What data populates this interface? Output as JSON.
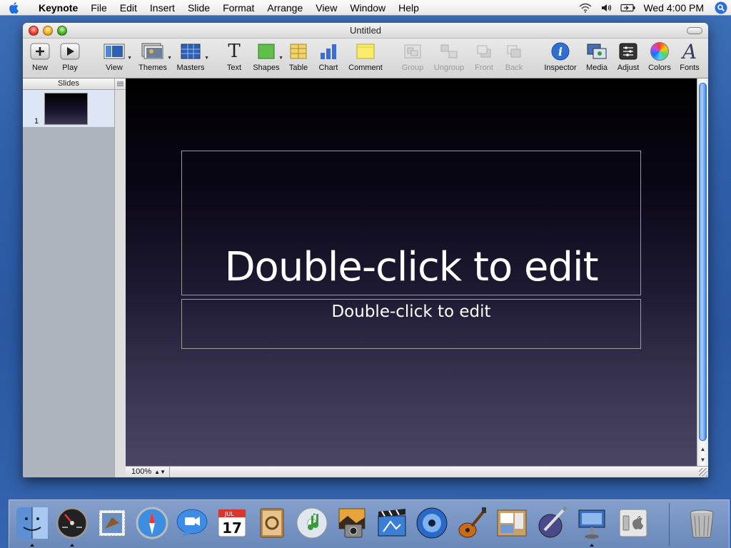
{
  "menubar": {
    "app": "Keynote",
    "items": [
      "File",
      "Edit",
      "Insert",
      "Slide",
      "Format",
      "Arrange",
      "View",
      "Window",
      "Help"
    ],
    "clock": "Wed 4:00 PM",
    "status_icons": [
      "wifi-icon",
      "volume-icon",
      "battery-icon"
    ]
  },
  "window": {
    "title": "Untitled"
  },
  "toolbar": {
    "new": "New",
    "play": "Play",
    "view": "View",
    "themes": "Themes",
    "masters": "Masters",
    "text": "Text",
    "shapes": "Shapes",
    "table": "Table",
    "chart": "Chart",
    "comment": "Comment",
    "group": "Group",
    "ungroup": "Ungroup",
    "front": "Front",
    "back": "Back",
    "inspector": "Inspector",
    "media": "Media",
    "adjust": "Adjust",
    "colors": "Colors",
    "fonts": "Fonts",
    "text_glyph": "T",
    "inspector_glyph": "i",
    "fonts_glyph": "A"
  },
  "navigator": {
    "header": "Slides",
    "slides": [
      {
        "number": "1"
      }
    ]
  },
  "slide": {
    "title_placeholder": "Double-click to edit",
    "body_placeholder": "Double-click to edit"
  },
  "bottombar": {
    "zoom": "100%"
  },
  "dock": {
    "items": [
      "Finder",
      "Dashboard",
      "Mail",
      "Safari",
      "iChat",
      "iCal",
      "Address Book",
      "iTunes",
      "iPhoto",
      "iMovie",
      "iDVD",
      "GarageBand",
      "iWeb",
      "Xcode",
      "Keynote",
      "Boot Camp",
      "Trash"
    ],
    "calendar_month": "JUL",
    "calendar_day": "17"
  },
  "colors": {
    "desktop": "#2f5ea8",
    "slide_top": "#000000",
    "slide_bottom": "#4b4663",
    "scroll_accent": "#3f82de"
  }
}
